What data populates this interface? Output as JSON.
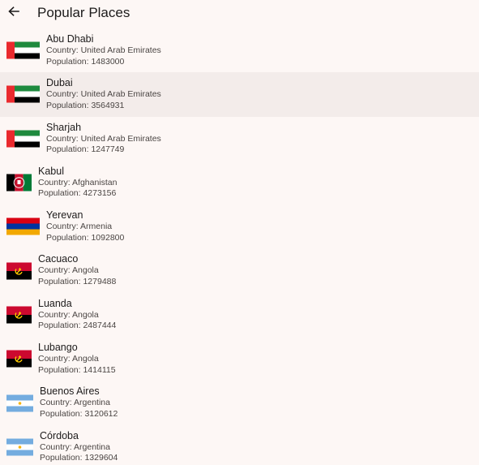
{
  "appbar": {
    "title": "Popular Places",
    "back_icon": "arrow-back-icon"
  },
  "places": [
    {
      "city": "Abu Dhabi",
      "country": "Country: United Arab Emirates",
      "population": "Population: 1483000",
      "flag": "uae-flag-icon",
      "selected": false
    },
    {
      "city": "Dubai",
      "country": "Country: United Arab Emirates",
      "population": "Population: 3564931",
      "flag": "uae-flag-icon",
      "selected": true
    },
    {
      "city": "Sharjah",
      "country": "Country: United Arab Emirates",
      "population": "Population: 1247749",
      "flag": "uae-flag-icon",
      "selected": false
    },
    {
      "city": "Kabul",
      "country": "Country: Afghanistan",
      "population": "Population: 4273156",
      "flag": "afghanistan-flag-icon",
      "selected": false
    },
    {
      "city": "Yerevan",
      "country": "Country: Armenia",
      "population": "Population: 1092800",
      "flag": "armenia-flag-icon",
      "selected": false
    },
    {
      "city": "Cacuaco",
      "country": "Country: Angola",
      "population": "Population: 1279488",
      "flag": "angola-flag-icon",
      "selected": false
    },
    {
      "city": "Luanda",
      "country": "Country: Angola",
      "population": "Population: 2487444",
      "flag": "angola-flag-icon",
      "selected": false
    },
    {
      "city": "Lubango",
      "country": "Country: Angola",
      "population": "Population: 1414115",
      "flag": "angola-flag-icon",
      "selected": false
    },
    {
      "city": "Buenos Aires",
      "country": "Country: Argentina",
      "population": "Population: 3120612",
      "flag": "argentina-flag-icon",
      "selected": false
    },
    {
      "city": "Córdoba",
      "country": "Country: Argentina",
      "population": "Population: 1329604",
      "flag": "argentina-flag-icon",
      "selected": false
    }
  ],
  "colors": {
    "background": "#fdf7f5",
    "selected_row": "#f3ecea",
    "uae_red": "#ea2a2e",
    "uae_green": "#1e8a3e",
    "afghanistan_red": "#c8102e",
    "afghanistan_green": "#007a36",
    "armenia_red": "#d90012",
    "armenia_blue": "#0033a0",
    "armenia_orange": "#f2a800",
    "angola_red": "#cc092f",
    "angola_yellow": "#ffcb00",
    "argentina_blue": "#74acdf",
    "argentina_sun": "#f6b40e"
  }
}
